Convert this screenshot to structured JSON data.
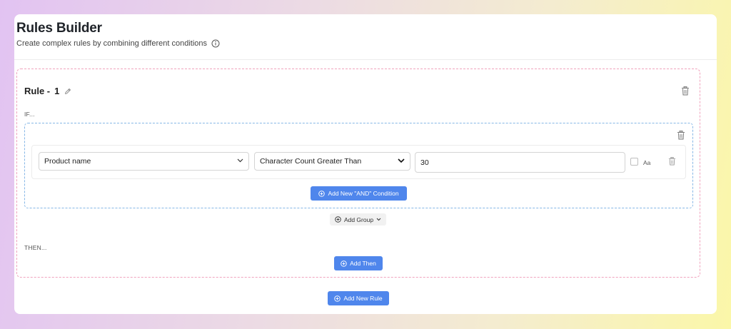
{
  "header": {
    "title": "Rules Builder",
    "subtitle": "Create complex rules by combining different conditions"
  },
  "rule": {
    "label": "Rule -",
    "number": "1",
    "if_label": "IF...",
    "then_label": "THEN...",
    "group": {
      "condition": {
        "field": "Product name",
        "operator": "Character Count Greater Than",
        "value": "30",
        "case_sensitive_label": "Aa",
        "case_sensitive_checked": false
      },
      "add_and_label": "Add New \"AND\" Condition"
    },
    "add_group_label": "Add Group",
    "add_then_label": "Add Then"
  },
  "add_rule_label": "Add New Rule",
  "colors": {
    "primary": "#4f86ec",
    "rule_border": "#f0a3bd",
    "group_border": "#86b7e6"
  }
}
